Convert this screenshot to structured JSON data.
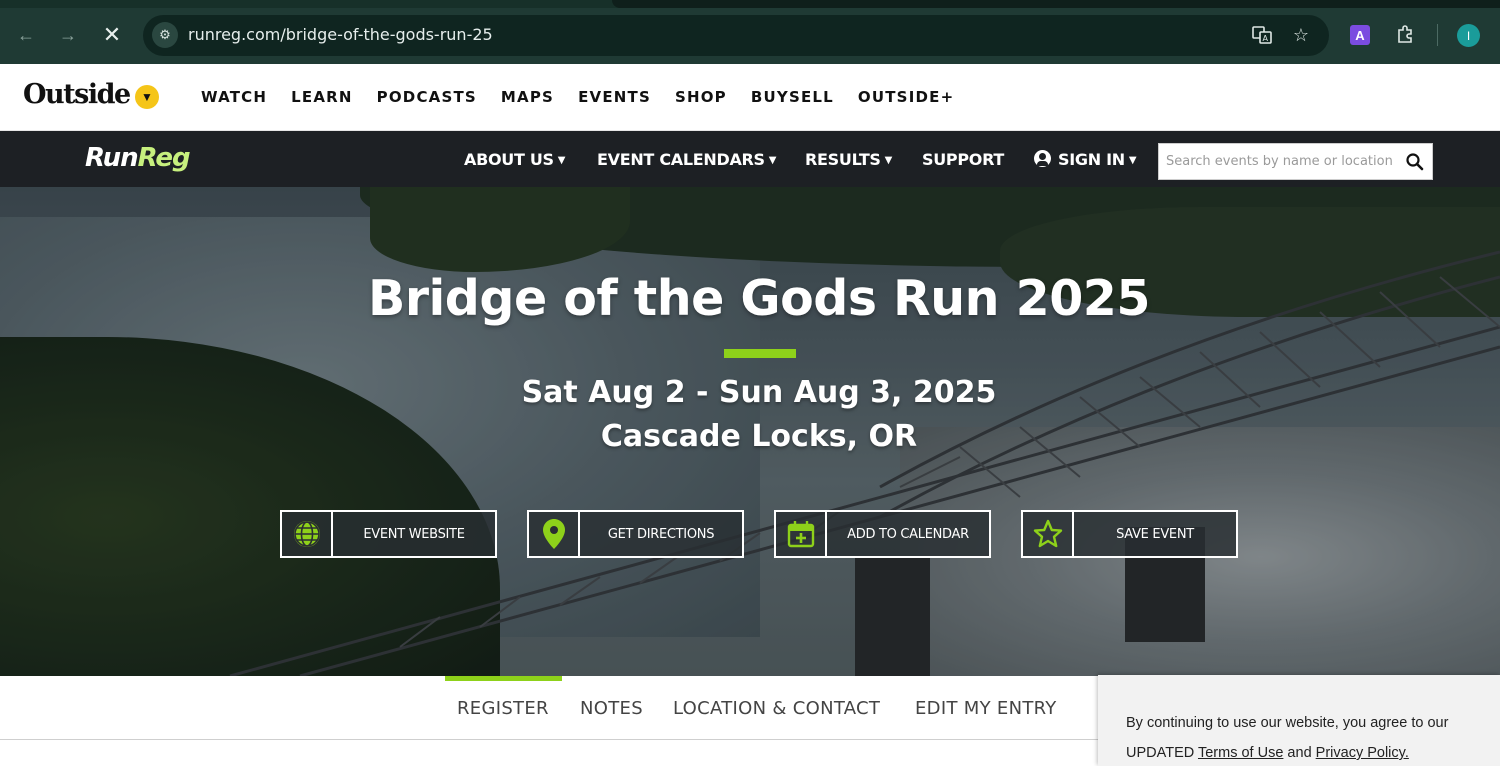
{
  "browser": {
    "url": "runreg.com/bridge-of-the-gods-run-25",
    "back_icon": "back-arrow-icon",
    "forward_icon": "forward-arrow-icon",
    "stop_icon": "stop-loading-icon",
    "profile_initial": "I",
    "extension_label": "A"
  },
  "outside_nav": {
    "logo": "Outside",
    "links": [
      "WATCH",
      "LEARN",
      "PODCASTS",
      "MAPS",
      "EVENTS",
      "SHOP",
      "BUYSELL",
      "OUTSIDE+"
    ]
  },
  "runreg_nav": {
    "logo_part1": "Run",
    "logo_part2": "Reg",
    "links": {
      "about": "ABOUT US",
      "calendars": "EVENT CALENDARS",
      "results": "RESULTS",
      "support": "SUPPORT",
      "signin": "SIGN IN"
    },
    "search_placeholder": "Search events by name or location"
  },
  "hero": {
    "title": "Bridge of the Gods Run 2025",
    "date": "Sat Aug 2 - Sun Aug 3, 2025",
    "location": "Cascade Locks, OR",
    "accent_color": "#8ed11a",
    "actions": {
      "website": "EVENT WEBSITE",
      "directions": "GET DIRECTIONS",
      "calendar": "ADD TO CALENDAR",
      "save": "SAVE EVENT"
    }
  },
  "tabs": {
    "register": "REGISTER",
    "notes": "NOTES",
    "location": "LOCATION & CONTACT",
    "edit": "EDIT MY ENTRY"
  },
  "cookie": {
    "text_before": "By continuing to use our website, you agree to our UPDATED ",
    "terms": "Terms of Use",
    "and": " and ",
    "privacy": "Privacy Policy."
  }
}
